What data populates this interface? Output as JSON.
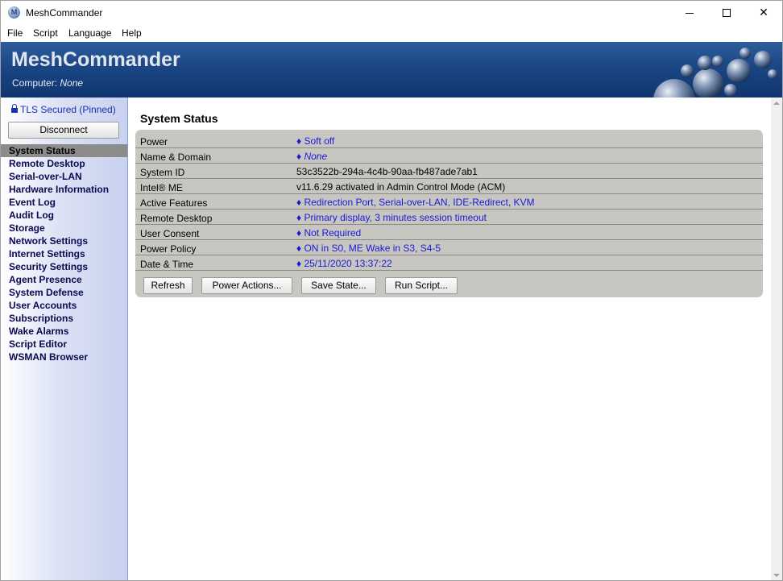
{
  "window": {
    "title": "MeshCommander"
  },
  "menu": {
    "file": "File",
    "script": "Script",
    "language": "Language",
    "help": "Help"
  },
  "header": {
    "title": "MeshCommander",
    "computer_label": "Computer: ",
    "computer_value": "None"
  },
  "sidebar": {
    "tls_status": "TLS Secured (Pinned)",
    "disconnect_label": "Disconnect",
    "items": [
      {
        "label": "System Status"
      },
      {
        "label": "Remote Desktop"
      },
      {
        "label": "Serial-over-LAN"
      },
      {
        "label": "Hardware Information"
      },
      {
        "label": "Event Log"
      },
      {
        "label": "Audit Log"
      },
      {
        "label": "Storage"
      },
      {
        "label": "Network Settings"
      },
      {
        "label": "Internet Settings"
      },
      {
        "label": "Security Settings"
      },
      {
        "label": "Agent Presence"
      },
      {
        "label": "System Defense"
      },
      {
        "label": "User Accounts"
      },
      {
        "label": "Subscriptions"
      },
      {
        "label": "Wake Alarms"
      },
      {
        "label": "Script Editor"
      },
      {
        "label": "WSMAN Browser"
      }
    ]
  },
  "main": {
    "title": "System Status",
    "rows": [
      {
        "label": "Power",
        "value": "♦ Soft off"
      },
      {
        "label": "Name & Domain",
        "value": "♦ None"
      },
      {
        "label": "System ID",
        "value": "53c3522b-294a-4c4b-90aa-fb487ade7ab1"
      },
      {
        "label": "Intel® ME",
        "value": "v11.6.29 activated in Admin Control Mode (ACM)"
      },
      {
        "label": "Active Features",
        "value": "♦ Redirection Port, Serial-over-LAN, IDE-Redirect, KVM"
      },
      {
        "label": "Remote Desktop",
        "value": "♦ Primary display, 3 minutes session timeout"
      },
      {
        "label": "User Consent",
        "value": "♦ Not Required"
      },
      {
        "label": "Power Policy",
        "value": "♦ ON in S0, ME Wake in S3, S4-5"
      },
      {
        "label": "Date & Time",
        "value": "♦ 25/11/2020 13:37:22"
      }
    ],
    "buttons": {
      "refresh": "Refresh",
      "power_actions": "Power Actions...",
      "save_state": "Save State...",
      "run_script": "Run Script..."
    }
  },
  "colors": {
    "banner": "#1b4584",
    "link": "#1a1ad6",
    "panel": "#c8c6c1",
    "nav_active": "#8c8c8c"
  }
}
